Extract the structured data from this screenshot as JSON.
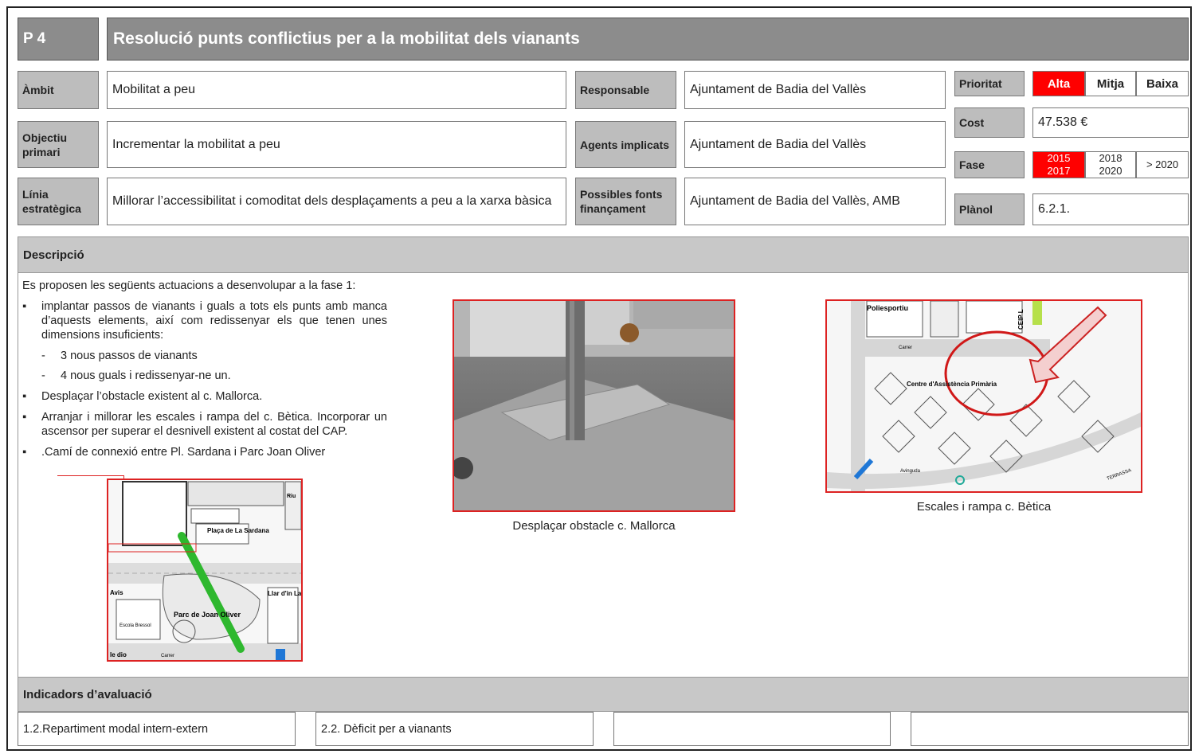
{
  "header": {
    "code": "P 4",
    "title": "Resolució punts conflictius per a la mobilitat dels vianants"
  },
  "fields": {
    "ambit": {
      "label": "Àmbit",
      "value": "Mobilitat a peu"
    },
    "objectiu": {
      "label": "Objectiu primari",
      "value": "Incrementar la mobilitat a peu"
    },
    "linia": {
      "label": "Línia estratègica",
      "value": "Millorar l’accessibilitat i comoditat dels desplaçaments a peu a la xarxa bàsica"
    },
    "responsable": {
      "label": "Responsable",
      "value": "Ajuntament de Badia del Vallès"
    },
    "agents": {
      "label": "Agents implicats",
      "value": "Ajuntament de Badia del Vallès"
    },
    "fonts": {
      "label": "Possibles fonts finançament",
      "value": "Ajuntament de Badia del Vallès, AMB"
    }
  },
  "prioritat": {
    "label": "Prioritat",
    "options": [
      "Alta",
      "Mitja",
      "Baixa"
    ],
    "selected": "Alta"
  },
  "cost": {
    "label": "Cost",
    "value": "47.538 €"
  },
  "fase": {
    "label": "Fase",
    "options": [
      "2015 2017",
      "2018 2020",
      "> 2020"
    ],
    "selected": "2015 2017"
  },
  "planol": {
    "label": "Plànol",
    "value": "6.2.1."
  },
  "descripcio": {
    "title": "Descripció",
    "intro": "Es proposen les següents actuacions a desenvolupar a la fase 1:",
    "items": [
      {
        "text": "implantar passos de vianants i guals a tots els punts amb manca d’aquests elements, així com redissenyar els que tenen unes dimensions insuficients:",
        "sub": [
          "3 nous passos de vianants",
          "4 nous guals i redissenyar-ne un."
        ]
      },
      {
        "text": "Desplaçar l’obstacle existent al c. Mallorca."
      },
      {
        "text": "Arranjar i millorar les escales i rampa del c. Bètica. Incorporar un ascensor per superar el desnivell existent al costat del CAP."
      },
      {
        "text": ".Camí de connexió entre Pl. Sardana i Parc Joan Oliver"
      }
    ],
    "bullet": "▪",
    "dash": "-"
  },
  "figures": {
    "map_small": {
      "labels": {
        "place": "Plaça de La Sardana",
        "park": "Parc de Joan Oliver",
        "llar": "Llar d'in La Mai",
        "avis": "Avis",
        "escola": "Escola Bressol",
        "ledio": "le dio",
        "carrer": "Carrer",
        "riu": "Riu"
      }
    },
    "photo": {
      "caption": "Desplaçar obstacle c. Mallorca"
    },
    "map_big": {
      "caption": "Escales i rampa c. Bètica",
      "labels": {
        "pol": "Poliesportiu",
        "ceip": "CEIP L",
        "cap": "Centre d'Assistència Primària",
        "carrer": "Carrer",
        "avda": "Avinguda",
        "tarrasa": "TERRASSA"
      }
    }
  },
  "indicadors": {
    "title": "Indicadors d’avaluació",
    "items": [
      "1.2.Repartiment modal intern-extern",
      "2.2. Dèficit per a vianants",
      "",
      ""
    ]
  }
}
